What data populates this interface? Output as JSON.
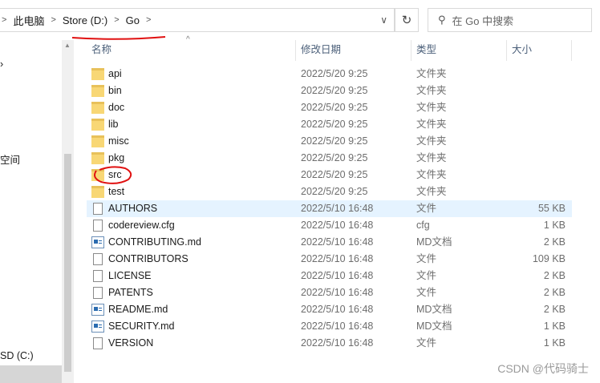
{
  "address": {
    "breadcrumb": [
      "此电脑",
      "Store (D:)",
      "Go"
    ],
    "refresh_icon": "refresh-icon"
  },
  "search": {
    "placeholder": "在 Go 中搜索"
  },
  "nav": {
    "items": [
      "空间",
      "SD (C:)"
    ]
  },
  "columns": {
    "name": "名称",
    "date": "修改日期",
    "type": "类型",
    "size": "大小"
  },
  "files": [
    {
      "name": "api",
      "date": "2022/5/20 9:25",
      "type": "文件夹",
      "size": "",
      "kind": "folder"
    },
    {
      "name": "bin",
      "date": "2022/5/20 9:25",
      "type": "文件夹",
      "size": "",
      "kind": "folder"
    },
    {
      "name": "doc",
      "date": "2022/5/20 9:25",
      "type": "文件夹",
      "size": "",
      "kind": "folder"
    },
    {
      "name": "lib",
      "date": "2022/5/20 9:25",
      "type": "文件夹",
      "size": "",
      "kind": "folder"
    },
    {
      "name": "misc",
      "date": "2022/5/20 9:25",
      "type": "文件夹",
      "size": "",
      "kind": "folder"
    },
    {
      "name": "pkg",
      "date": "2022/5/20 9:25",
      "type": "文件夹",
      "size": "",
      "kind": "folder"
    },
    {
      "name": "src",
      "date": "2022/5/20 9:25",
      "type": "文件夹",
      "size": "",
      "kind": "folder"
    },
    {
      "name": "test",
      "date": "2022/5/20 9:25",
      "type": "文件夹",
      "size": "",
      "kind": "folder"
    },
    {
      "name": "AUTHORS",
      "date": "2022/5/10 16:48",
      "type": "文件",
      "size": "55 KB",
      "kind": "file"
    },
    {
      "name": "codereview.cfg",
      "date": "2022/5/10 16:48",
      "type": "cfg",
      "size": "1 KB",
      "kind": "file"
    },
    {
      "name": "CONTRIBUTING.md",
      "date": "2022/5/10 16:48",
      "type": "MD文档",
      "size": "2 KB",
      "kind": "md"
    },
    {
      "name": "CONTRIBUTORS",
      "date": "2022/5/10 16:48",
      "type": "文件",
      "size": "109 KB",
      "kind": "file"
    },
    {
      "name": "LICENSE",
      "date": "2022/5/10 16:48",
      "type": "文件",
      "size": "2 KB",
      "kind": "file"
    },
    {
      "name": "PATENTS",
      "date": "2022/5/10 16:48",
      "type": "文件",
      "size": "2 KB",
      "kind": "file"
    },
    {
      "name": "README.md",
      "date": "2022/5/10 16:48",
      "type": "MD文档",
      "size": "2 KB",
      "kind": "md"
    },
    {
      "name": "SECURITY.md",
      "date": "2022/5/10 16:48",
      "type": "MD文档",
      "size": "1 KB",
      "kind": "md"
    },
    {
      "name": "VERSION",
      "date": "2022/5/10 16:48",
      "type": "文件",
      "size": "1 KB",
      "kind": "file"
    }
  ],
  "highlighted_row": "AUTHORS",
  "annotation_color": "#e01010",
  "watermark": "CSDN @代码骑士"
}
